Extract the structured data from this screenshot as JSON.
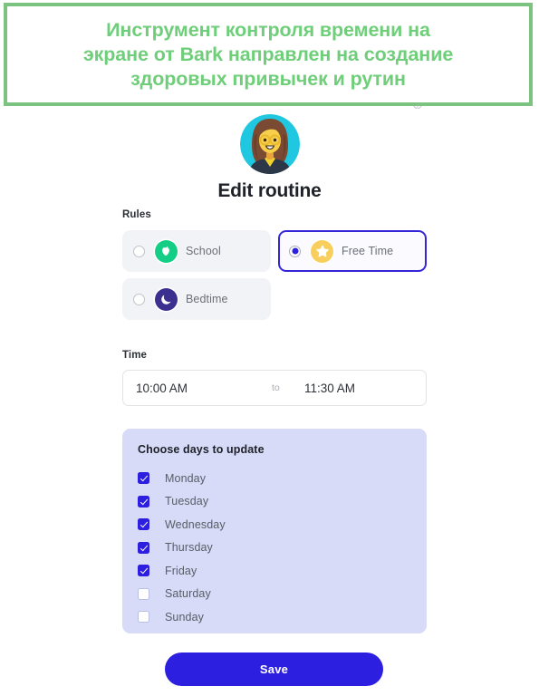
{
  "banner": {
    "caption": "Инструмент контроля времени на\nэкране от Bark направлен на создание\nздоровых привычек и рутин",
    "border_color": "#7ac47f",
    "text_color": "#6fce79",
    "overlay_mark": "✳"
  },
  "app": {
    "avatar_alt": "woman-with-glasses-avatar",
    "title": "Edit routine",
    "rules": {
      "label": "Rules",
      "options": [
        {
          "id": "school",
          "label": "School",
          "icon": "apple-icon",
          "icon_color": "#13ce84",
          "selected": false
        },
        {
          "id": "freetime",
          "label": "Free Time",
          "icon": "star-icon",
          "icon_color": "#f8cf5c",
          "selected": true
        },
        {
          "id": "bedtime",
          "label": "Bedtime",
          "icon": "moon-icon",
          "icon_color": "#3b2f8f",
          "selected": false
        }
      ]
    },
    "time": {
      "label": "Time",
      "start": "10:00 AM",
      "separator": "to",
      "end": "11:30 AM"
    },
    "days": {
      "title": "Choose days to update",
      "panel_color": "#d7dbf8",
      "items": [
        {
          "label": "Monday",
          "checked": true
        },
        {
          "label": "Tuesday",
          "checked": true
        },
        {
          "label": "Wednesday",
          "checked": true
        },
        {
          "label": "Thursday",
          "checked": true
        },
        {
          "label": "Friday",
          "checked": true
        },
        {
          "label": "Saturday",
          "checked": false
        },
        {
          "label": "Sunday",
          "checked": false
        }
      ]
    },
    "save": {
      "label": "Save",
      "color": "#2d1fe0"
    }
  }
}
